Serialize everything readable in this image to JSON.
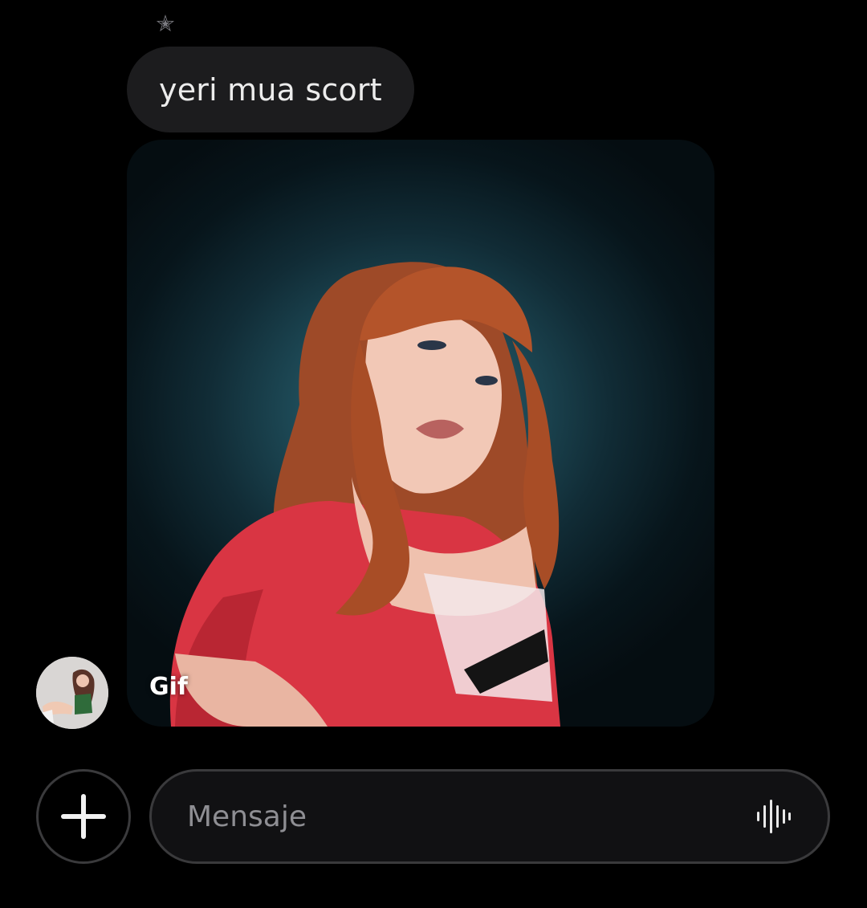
{
  "conversation": {
    "reaction_icon": "star-icon",
    "reaction_glyph": "✭",
    "message_text": "yeri mua scort",
    "gif": {
      "badge_label": "Gif",
      "background_colors": [
        "#2f6f7d",
        "#07151b"
      ]
    },
    "sender_avatar": "avatar"
  },
  "composer": {
    "add_icon": "plus-icon",
    "placeholder": "Mensaje",
    "value": "",
    "voice_icon": "voice-waveform-icon"
  },
  "colors": {
    "background": "#000000",
    "bubble": "#1c1c1e",
    "field_border": "#3a3a3c",
    "placeholder": "#8e8e93"
  }
}
